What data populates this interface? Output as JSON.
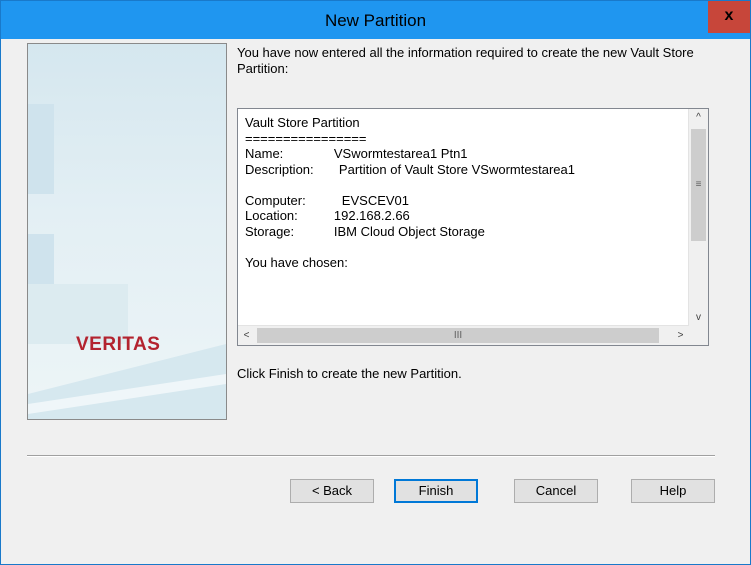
{
  "window": {
    "title": "New Partition",
    "close_label": "x"
  },
  "side_panel": {
    "logo_text": "VERITAS",
    "logo_color": "#b3232f"
  },
  "main": {
    "intro": "You have now entered all the information required to create the new Vault Store Partition:",
    "summary_text": "Vault Store Partition\n================\nName:              VSwormtestarea1 Ptn1\nDescription:       Partition of Vault Store VSwormtestarea1\n\nComputer:          EVSCEV01\nLocation:          192.168.2.66\nStorage:           IBM Cloud Object Storage\n\nYou have chosen:",
    "footer_note": "Click Finish to create the new Partition."
  },
  "scrollbars": {
    "up_icon": "^",
    "down_icon": "v",
    "left_icon": "<",
    "right_icon": ">",
    "vgrip": "≡",
    "hgrip": "III"
  },
  "buttons": {
    "back": "< Back",
    "finish": "Finish",
    "cancel": "Cancel",
    "help": "Help"
  },
  "colors": {
    "titlebar": "#1f96f0",
    "close": "#c7463a",
    "default_button_border": "#0078d7"
  }
}
